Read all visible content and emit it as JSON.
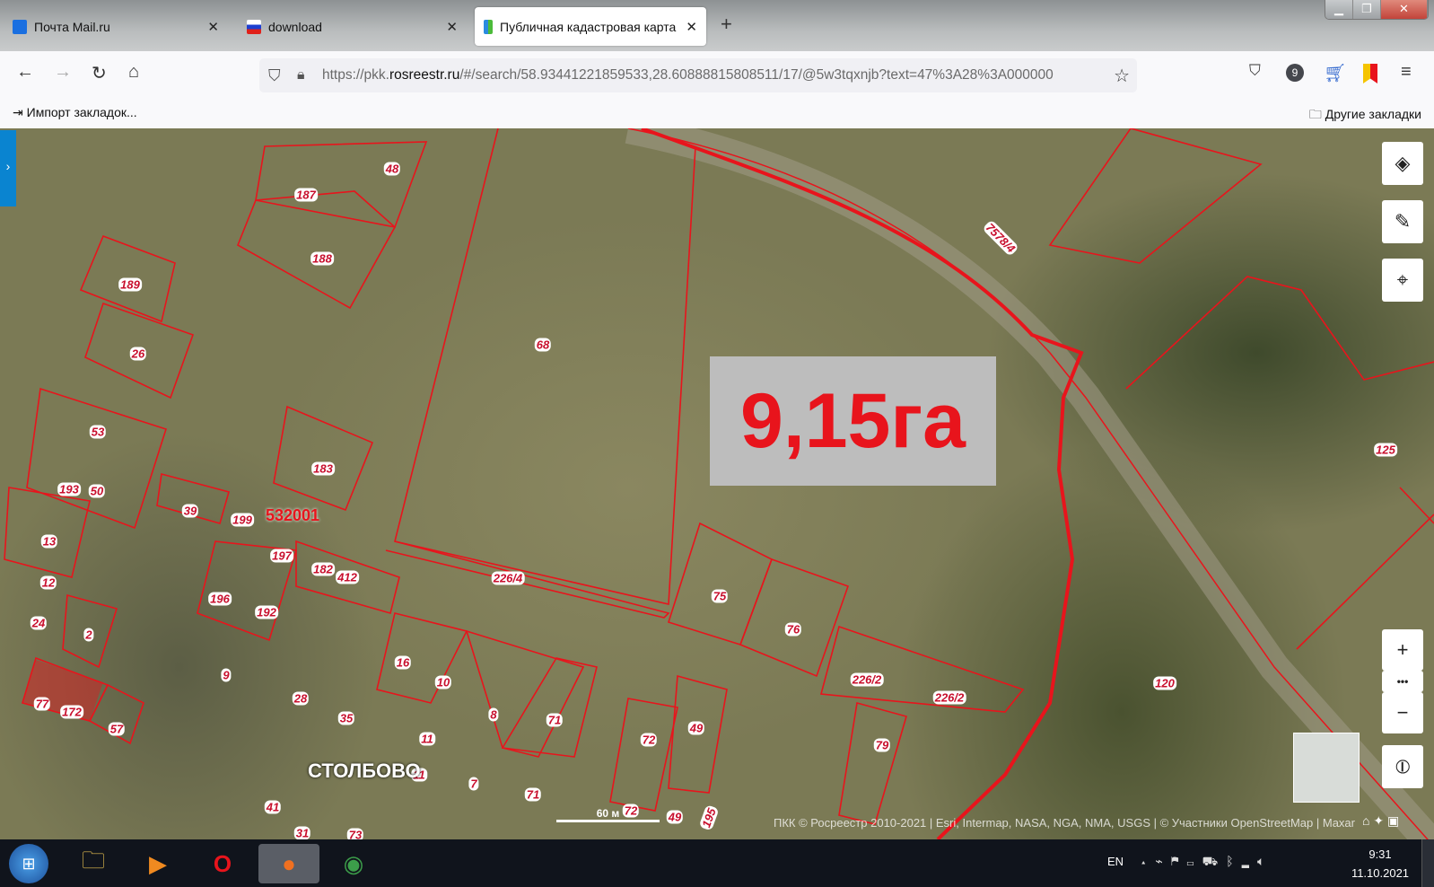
{
  "browser": {
    "tabs": [
      {
        "label": "Почта Mail.ru",
        "active": false
      },
      {
        "label": "download",
        "active": false
      },
      {
        "label": "Публичная кадастровая карта",
        "active": true
      }
    ],
    "url_prefix": "https://pkk.",
    "url_domain": "rosreestr.ru",
    "url_rest": "/#/search/58.93441221859533,28.60888815808511/17/@5w3tqxnjb?text=47%3A28%3A000000",
    "badge_count": "9",
    "bookmarks": {
      "import": "Импорт закладок...",
      "other": "Другие закладки"
    }
  },
  "map": {
    "area_label": "9,15га",
    "quarter": "532001",
    "village": "СТОЛБОВО",
    "road_parcel": "7578/4",
    "parcels": [
      "187",
      "48",
      "188",
      "189",
      "26",
      "68",
      "53",
      "193",
      "50",
      "183",
      "39",
      "199",
      "13",
      "197",
      "182",
      "412",
      "226/4",
      "12",
      "196",
      "192",
      "75",
      "76",
      "24",
      "2",
      "9",
      "16",
      "10",
      "28",
      "8",
      "71",
      "226/2",
      "226/2",
      "120",
      "125",
      "77",
      "172",
      "57",
      "35",
      "11",
      "72",
      "49",
      "79",
      "11",
      "7",
      "71",
      "72",
      "49",
      "195",
      "41",
      "31",
      "73"
    ],
    "scale": "60 м",
    "attribution": "ПКК © Росреестр 2010-2021 | Esri, Intermap, NASA, NGA, NMA, USGS | © Участники OpenStreetMap | Maxar",
    "controls": [
      "layers-icon",
      "ruler-icon",
      "locate-icon",
      "zoom-in",
      "more",
      "zoom-out",
      "compass-icon"
    ],
    "zoom_in": "+",
    "zoom_out": "−",
    "more": "•••"
  },
  "taskbar": {
    "lang": "EN",
    "time": "9:31",
    "date": "11.10.2021"
  },
  "colors": {
    "parcel": "#e8141c",
    "accent": "#0a84d0"
  }
}
